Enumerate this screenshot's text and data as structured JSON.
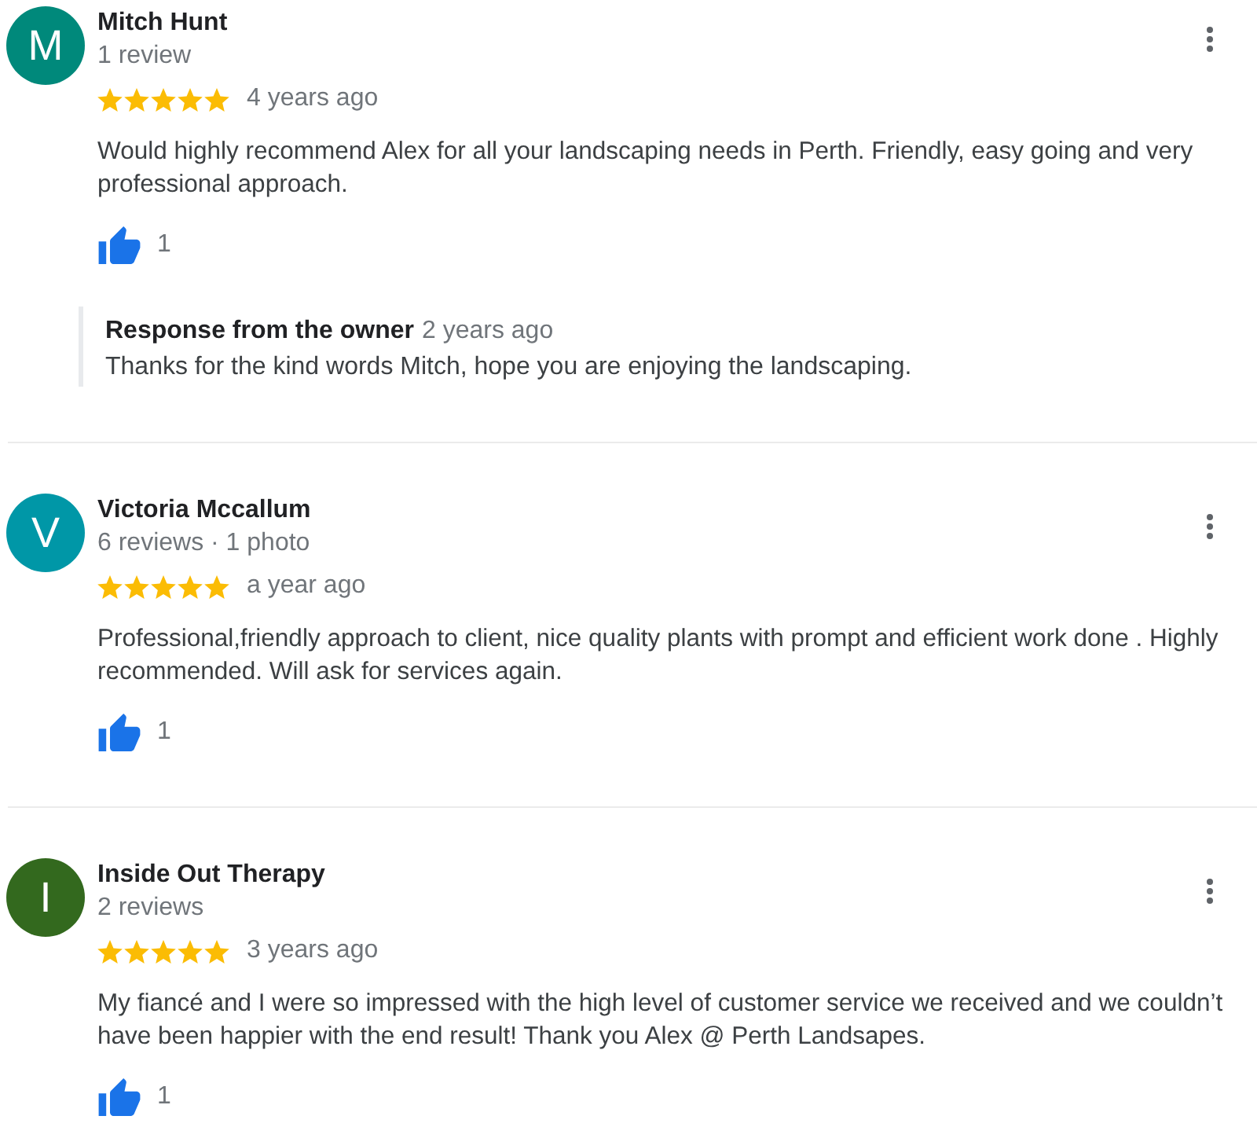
{
  "reviews": [
    {
      "avatar": {
        "initial": "M",
        "color": "#00897b"
      },
      "name": "Mitch Hunt",
      "meta": "1 review",
      "stars": 5,
      "time": "4 years ago",
      "text": "Would highly recommend Alex for all your landscaping needs in Perth. Friendly, easy going and very professional approach.",
      "likes": "1",
      "owner_response": {
        "title": "Response from the owner",
        "time": "2 years ago",
        "text": "Thanks for the kind words Mitch, hope you are enjoying the landscaping."
      }
    },
    {
      "avatar": {
        "initial": "V",
        "color": "#0097a7"
      },
      "name": "Victoria Mccallum",
      "meta": "6 reviews · 1 photo",
      "stars": 5,
      "time": "a year ago",
      "text": "Professional,friendly approach to client, nice quality plants with prompt and efficient work done . Highly recommended. Will ask for services again.",
      "likes": "1"
    },
    {
      "avatar": {
        "initial": "I",
        "color": "#33691e"
      },
      "name": "Inside Out Therapy",
      "meta": "2 reviews",
      "stars": 5,
      "time": "3 years ago",
      "text": "My fiancé and I were so impressed with the high level of customer service we received and we couldn’t have been happier with the end result! Thank you Alex @ Perth Landsapes.",
      "likes": "1"
    }
  ]
}
